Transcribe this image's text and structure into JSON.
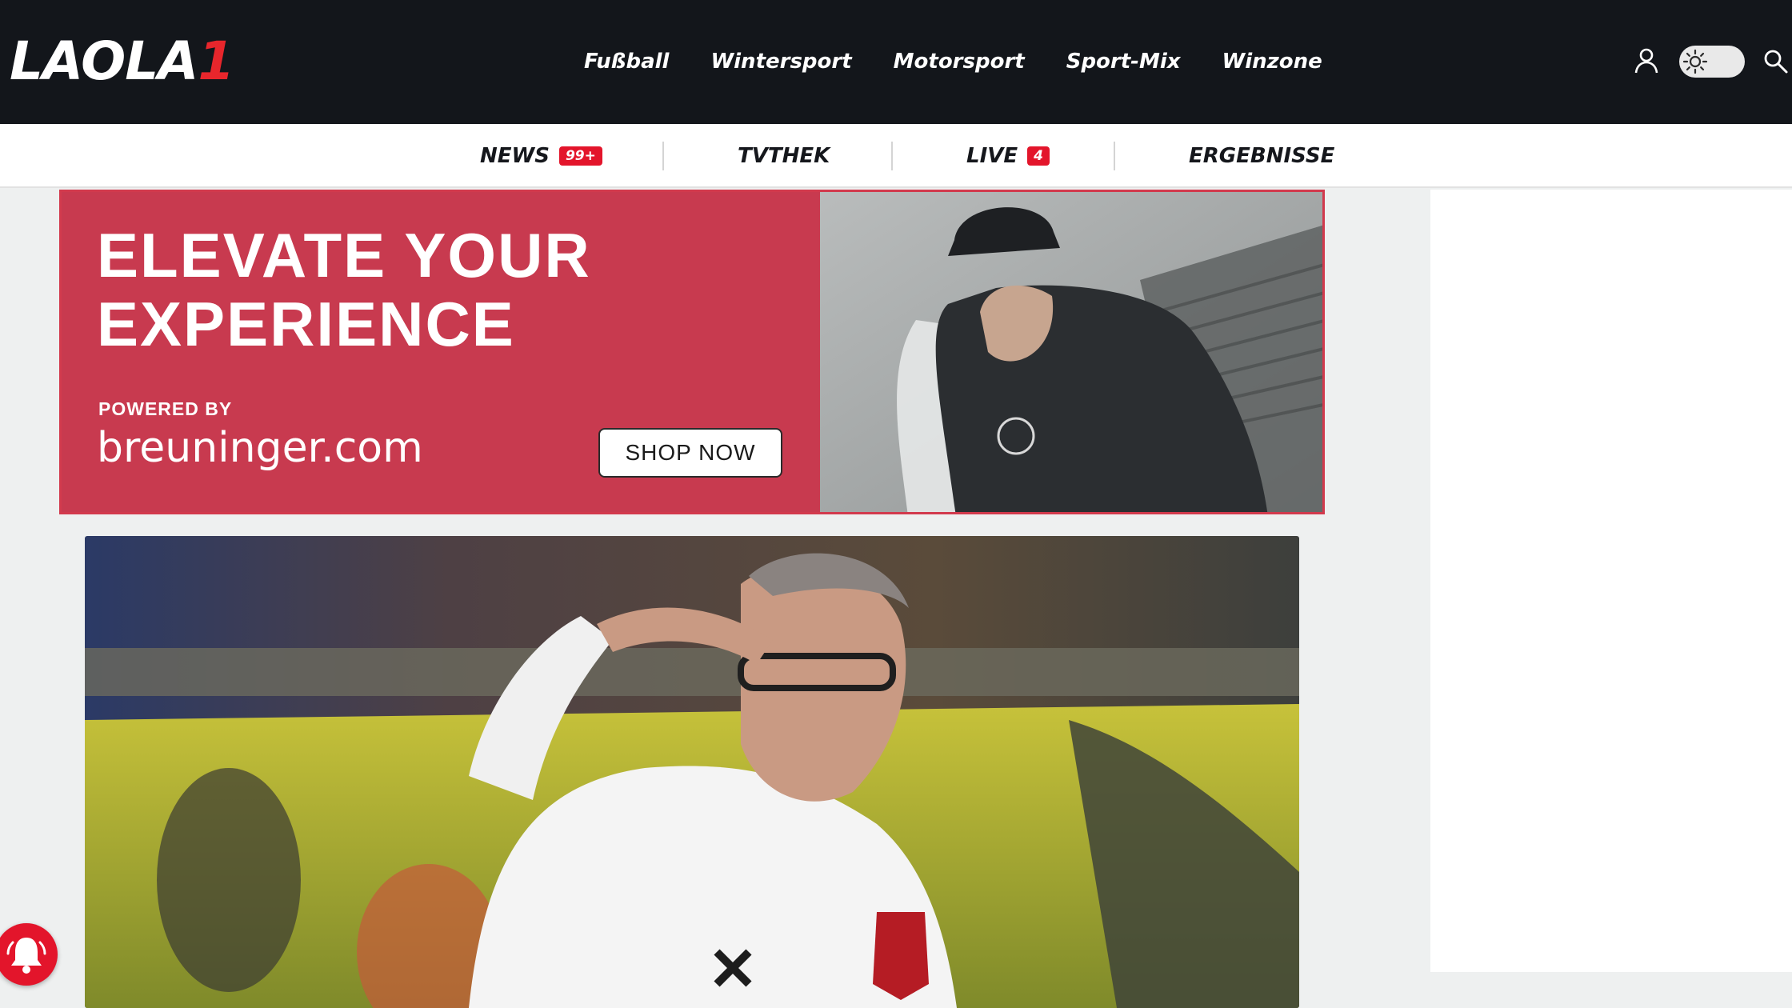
{
  "header": {
    "logo_text": "LAOLA",
    "logo_accent": "1",
    "nav": [
      "Fußball",
      "Wintersport",
      "Motorsport",
      "Sport-Mix",
      "Winzone"
    ],
    "icons": [
      "user-icon",
      "theme-toggle-sun-icon",
      "search-icon"
    ],
    "colors": {
      "background": "#13161b",
      "accent": "#e8262c"
    }
  },
  "subnav": {
    "news": {
      "label": "NEWS",
      "badge": "99+"
    },
    "tvthek": {
      "label": "TVTHEK"
    },
    "live": {
      "label": "LIVE",
      "badge": "4"
    },
    "results": {
      "label": "ERGEBNISSE"
    }
  },
  "ad": {
    "title_line1": "ELEVATE YOUR",
    "title_line2": "EXPERIENCE",
    "powered_by": "POWERED BY",
    "brand": "breuninger.com",
    "cta": "SHOP NOW",
    "background": "#c83a4f"
  },
  "notification": {
    "icon": "bell-icon",
    "color": "#e3152b"
  }
}
